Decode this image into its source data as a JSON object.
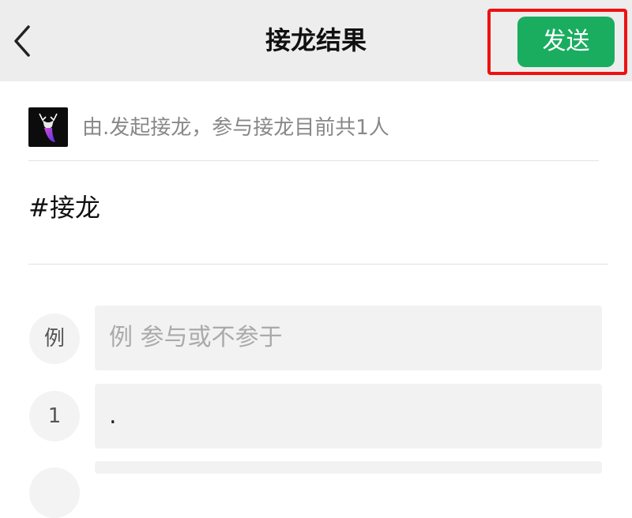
{
  "header": {
    "title": "接龙结果",
    "send_label": "发送",
    "back_icon": "chevron-left-icon"
  },
  "info": {
    "text": "由.发起接龙，参与接龙目前共1人"
  },
  "topic": {
    "text": "#接龙"
  },
  "entries": [
    {
      "label": "例",
      "placeholder": "例 参与或不参于",
      "value": ""
    },
    {
      "label": "1",
      "value": "."
    }
  ],
  "colors": {
    "header_bg": "#ededed",
    "send_button": "#1aad60",
    "highlight_border": "#ee1111"
  }
}
